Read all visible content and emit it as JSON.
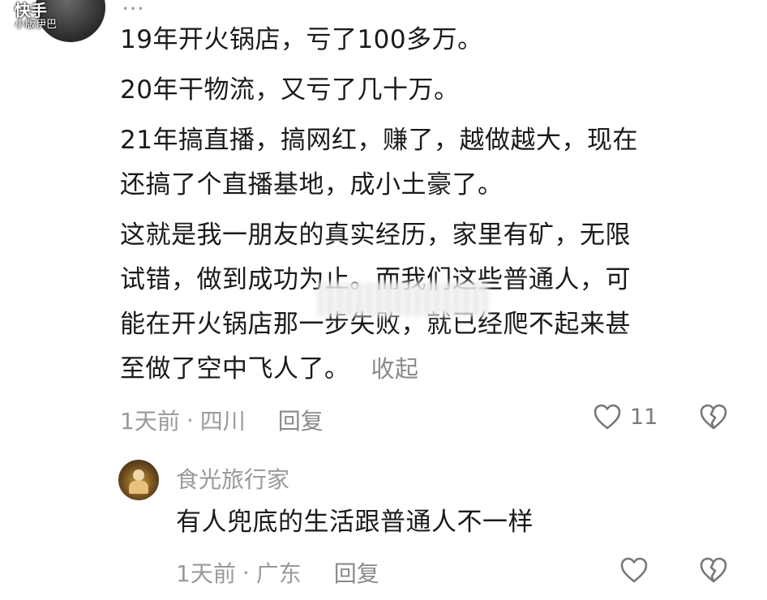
{
  "top_comment": {
    "username": "…",
    "watermark_brand": "快手",
    "watermark_user": "小版伊巴",
    "paragraphs": [
      "19年开火锅店，亏了100多万。",
      "20年干物流，又亏了几十万。",
      "21年搞直播，搞网红，赚了，越做越大，现在\n还搞了个直播基地，成小土豪了。",
      "这就是我一朋友的真实经历，家里有矿，无限\n试错，做到成功为止。而我们这些普通人，可\n能在开火锅店那一步失败，就已经爬不起来甚\n至做了空中飞人了。"
    ],
    "collapse_label": "收起",
    "time": "1天前",
    "separator": "·",
    "location": "四川",
    "reply_label": "回复",
    "like_count": "11",
    "icons": {
      "like": "heart-outline-icon",
      "dislike": "broken-heart-icon"
    }
  },
  "reply_comment": {
    "username": "食光旅行家",
    "text": "有人兜底的生活跟普通人不一样",
    "time": "1天前",
    "separator": "·",
    "location": "广东",
    "reply_label": "回复",
    "icons": {
      "like": "heart-outline-icon",
      "dislike": "broken-heart-icon"
    }
  },
  "colors": {
    "text": "#1a1a1a",
    "muted": "#9a9a9a",
    "icon": "#7a7a7a"
  }
}
